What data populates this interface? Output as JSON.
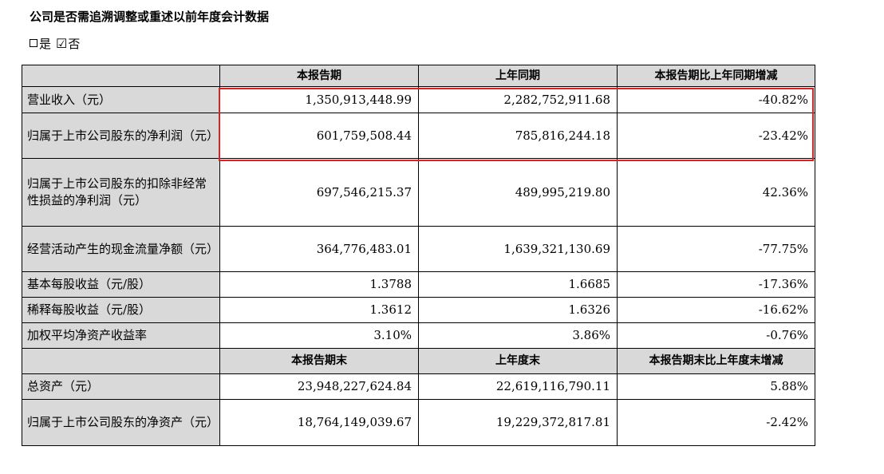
{
  "title": "公司是否需追溯调整或重述以前年度会计数据",
  "choice": {
    "yes_label": "是",
    "no_label": "否",
    "checked_mark": "☑"
  },
  "header1": [
    "",
    "本报告期",
    "上年同期",
    "本报告期比上年同期增减"
  ],
  "rows1": [
    [
      "营业收入（元）",
      "1,350,913,448.99",
      "2,282,752,911.68",
      "-40.82%"
    ],
    [
      "归属于上市公司股东的净利润（元）",
      "601,759,508.44",
      "785,816,244.18",
      "-23.42%"
    ],
    [
      "归属于上市公司股东的扣除非经常性损益的净利润（元）",
      "697,546,215.37",
      "489,995,219.80",
      "42.36%"
    ],
    [
      "经营活动产生的现金流量净额（元）",
      "364,776,483.01",
      "1,639,321,130.69",
      "-77.75%"
    ],
    [
      "基本每股收益（元/股）",
      "1.3788",
      "1.6685",
      "-17.36%"
    ],
    [
      "稀释每股收益（元/股）",
      "1.3612",
      "1.6326",
      "-16.62%"
    ],
    [
      "加权平均净资产收益率",
      "3.10%",
      "3.86%",
      "-0.76%"
    ]
  ],
  "header2": [
    "",
    "本报告期末",
    "上年度末",
    "本报告期末比上年度末增减"
  ],
  "rows2": [
    [
      "总资产（元）",
      "23,948,227,624.84",
      "22,619,116,790.11",
      "5.88%"
    ],
    [
      "归属于上市公司股东的净资产（元）",
      "18,764,149,039.67",
      "19,229,372,817.81",
      "-2.42%"
    ]
  ]
}
